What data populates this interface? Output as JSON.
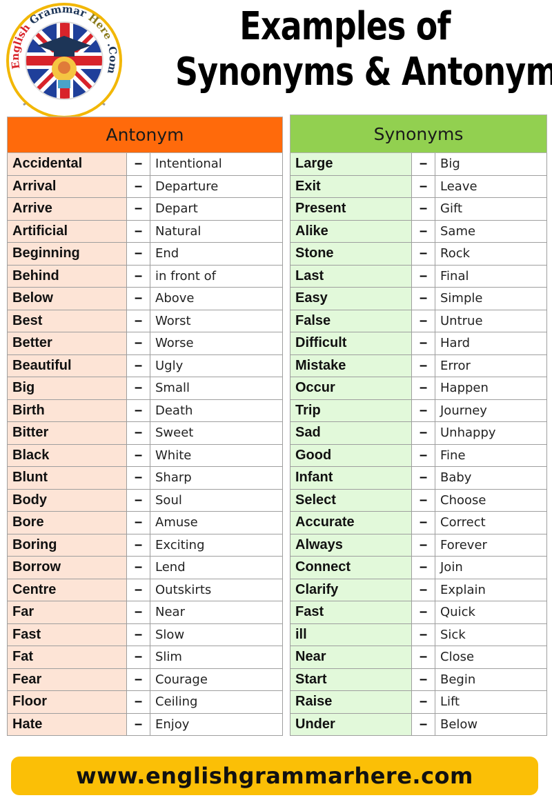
{
  "logo": {
    "text_left": "English",
    "text_top": "Grammar",
    "text_right": "Here",
    "text_end": ".Com"
  },
  "title": {
    "line1": "Examples of",
    "line2": "Synonyms & Antonyms"
  },
  "antonyms": {
    "header": "Antonym",
    "separator": "–",
    "rows": [
      {
        "word": "Accidental",
        "pair": "Intentional"
      },
      {
        "word": "Arrival",
        "pair": "Departure"
      },
      {
        "word": "Arrive",
        "pair": "Depart"
      },
      {
        "word": "Artificial",
        "pair": "Natural"
      },
      {
        "word": "Beginning",
        "pair": "End"
      },
      {
        "word": "Behind",
        "pair": "in front of"
      },
      {
        "word": "Below",
        "pair": "Above"
      },
      {
        "word": "Best",
        "pair": "Worst"
      },
      {
        "word": "Better",
        "pair": "Worse"
      },
      {
        "word": "Beautiful",
        "pair": "Ugly"
      },
      {
        "word": "Big",
        "pair": "Small"
      },
      {
        "word": "Birth",
        "pair": "Death"
      },
      {
        "word": "Bitter",
        "pair": "Sweet"
      },
      {
        "word": "Black",
        "pair": "White"
      },
      {
        "word": "Blunt",
        "pair": "Sharp"
      },
      {
        "word": "Body",
        "pair": "Soul"
      },
      {
        "word": "Bore",
        "pair": "Amuse"
      },
      {
        "word": "Boring",
        "pair": "Exciting"
      },
      {
        "word": "Borrow",
        "pair": "Lend"
      },
      {
        "word": "Centre",
        "pair": "Outskirts"
      },
      {
        "word": "Far",
        "pair": "Near"
      },
      {
        "word": "Fast",
        "pair": "Slow"
      },
      {
        "word": "Fat",
        "pair": "Slim"
      },
      {
        "word": "Fear",
        "pair": "Courage"
      },
      {
        "word": "Floor",
        "pair": "Ceiling"
      },
      {
        "word": "Hate",
        "pair": "Enjoy"
      }
    ]
  },
  "synonyms": {
    "header": "Synonyms",
    "separator": "–",
    "rows": [
      {
        "word": "Large",
        "pair": "Big"
      },
      {
        "word": "Exit",
        "pair": "Leave"
      },
      {
        "word": "Present",
        "pair": "Gift"
      },
      {
        "word": "Alike",
        "pair": "Same"
      },
      {
        "word": "Stone",
        "pair": "Rock"
      },
      {
        "word": "Last",
        "pair": "Final"
      },
      {
        "word": "Easy",
        "pair": "Simple"
      },
      {
        "word": "False",
        "pair": "Untrue"
      },
      {
        "word": "Difficult",
        "pair": "Hard"
      },
      {
        "word": "Mistake",
        "pair": "Error"
      },
      {
        "word": "Occur",
        "pair": "Happen"
      },
      {
        "word": "Trip",
        "pair": "Journey"
      },
      {
        "word": "Sad",
        "pair": "Unhappy"
      },
      {
        "word": "Good",
        "pair": "Fine"
      },
      {
        "word": "Infant",
        "pair": "Baby"
      },
      {
        "word": "Select",
        "pair": "Choose"
      },
      {
        "word": "Accurate",
        "pair": "Correct"
      },
      {
        "word": "Always",
        "pair": "Forever"
      },
      {
        "word": "Connect",
        "pair": "Join"
      },
      {
        "word": "Clarify",
        "pair": "Explain"
      },
      {
        "word": "Fast",
        "pair": "Quick"
      },
      {
        "word": "ill",
        "pair": "Sick"
      },
      {
        "word": "Near",
        "pair": "Close"
      },
      {
        "word": "Start",
        "pair": "Begin"
      },
      {
        "word": "Raise",
        "pair": "Lift"
      },
      {
        "word": "Under",
        "pair": "Below"
      }
    ]
  },
  "footer": {
    "url": "www.englishgrammarhere.com"
  },
  "colors": {
    "antonym_header": "#ff6a0b",
    "antonym_word_bg": "#fde4d6",
    "synonym_header": "#92d050",
    "synonym_word_bg": "#e2f9da",
    "footer_bg": "#fbbf06"
  }
}
